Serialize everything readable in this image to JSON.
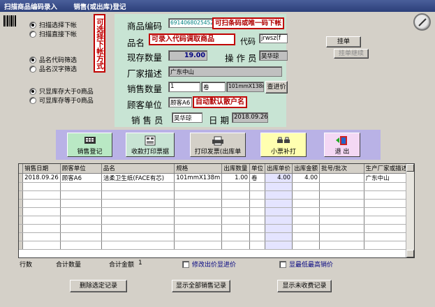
{
  "window": {
    "title": "扫描商品编码录入",
    "subtitle": "销售(或出库)登记"
  },
  "options": {
    "scan_group": [
      {
        "label": "扫描选择下帐",
        "checked": true
      },
      {
        "label": "扫描直接下帐",
        "checked": false
      }
    ],
    "name_group": [
      {
        "label": "品名代码筛选",
        "checked": true
      },
      {
        "label": "品名汉字筛选",
        "checked": false
      }
    ],
    "stock_group": [
      {
        "label": "只显库存大于0商品",
        "checked": true
      },
      {
        "label": "可显库存等于0商品",
        "checked": false
      }
    ],
    "vertical_note": "可选择下帐方式"
  },
  "form": {
    "code_label": "商品编码",
    "code_value": "6914068025452",
    "code_note": "可扫条码或唯一码下帐",
    "name_label": "品名",
    "name_note": "可录入代码调取商品",
    "name_code_label": "代码",
    "name_code_value": "jrwsz(f",
    "stock_label": "现存数量",
    "stock_value": "19.00",
    "operator_label": "操 作 员",
    "operator_value": "吴华琼",
    "maker_label": "厂家描述",
    "maker_value": "广东中山",
    "qty_label": "销售数量",
    "qty_value": "1",
    "unit_value": "卷",
    "spec_value": "101mmX138m",
    "price_btn": "查进价",
    "customer_label": "顾客单位",
    "customer_value": "顾客A6",
    "customer_note": "自动默认散户名",
    "seller_label": "销 售 员",
    "seller_value": "吴华琼",
    "date_label": "日 期",
    "date_value": "2018.09.26"
  },
  "side_buttons": {
    "hang": "挂单",
    "unhang": "挂单继续"
  },
  "toolbar": [
    {
      "label": "销售登记",
      "icon": "register-icon",
      "bg": "#b9e8c4"
    },
    {
      "label": "收款打印票据",
      "icon": "receipt-icon",
      "bg": "#c8e4d4"
    },
    {
      "label": "打印发票(出库单",
      "icon": "printer-icon",
      "bg": "#d4d0c8"
    },
    {
      "label": "小票补打",
      "icon": "small-printer-icon",
      "bg": "#ffffb0"
    },
    {
      "label": "退 出",
      "icon": "exit-door-icon",
      "bg": "#f4d8f4"
    }
  ],
  "grid": {
    "headers": [
      "销售日期",
      "顾客单位",
      "品名",
      "规格",
      "出库数量",
      "单位",
      "出库单价",
      "出库金额",
      "批号/批次",
      "生产厂家或描述"
    ],
    "rows": [
      [
        "2018.09.26",
        "顾客A6",
        "洁柔卫生纸(FACE有芯)",
        "101mmX138m",
        "1.00",
        "卷",
        "4.00",
        "4.00",
        "",
        "广东中山"
      ]
    ]
  },
  "summary": {
    "rows_label": "行数",
    "qty_label": "合计数量",
    "amount_label": "合计金额",
    "amount_value": "1",
    "chk_price_label": "修改出价显进价",
    "chk_lowest_label": "显最低最高销价"
  },
  "bottom_buttons": {
    "delete": "删除选定记录",
    "show_all": "显示全部销售记录",
    "show_unpaid": "显示未收费记录"
  }
}
